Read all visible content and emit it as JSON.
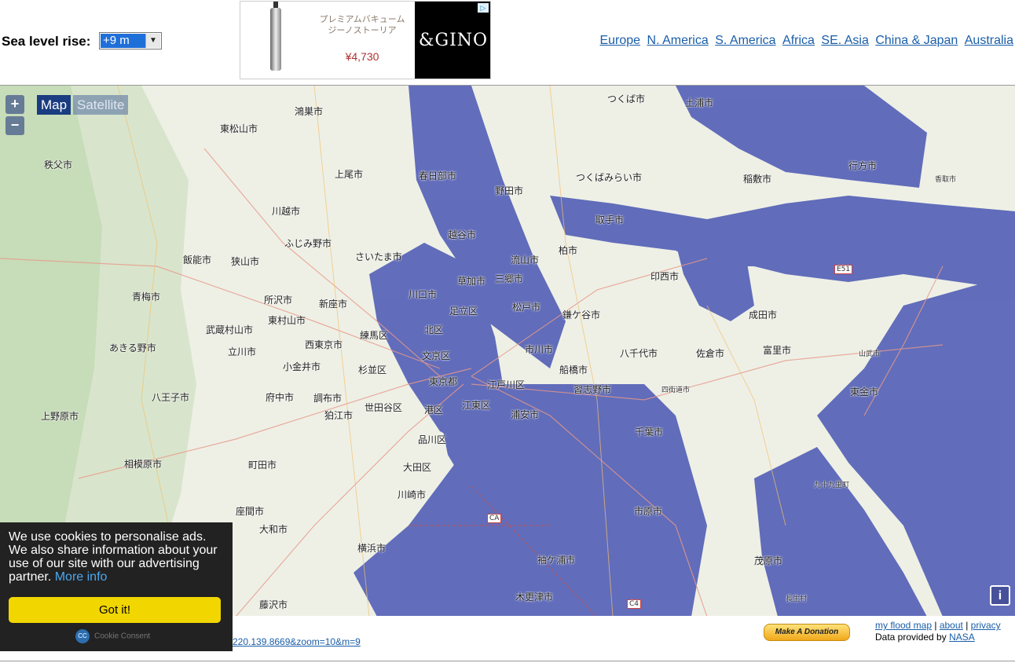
{
  "header": {
    "sea_level_label": "Sea level rise:",
    "sea_level_value": "+9 m"
  },
  "ad": {
    "product_text": "プレミアムバキューム ジーノストーリア",
    "price": "¥4,730",
    "brand": "&GINO"
  },
  "regions": [
    "Europe",
    "N. America",
    "S. America",
    "Africa",
    "SE. Asia",
    "China & Japan",
    "Australia"
  ],
  "map_controls": {
    "zoom_in": "+",
    "zoom_out": "−",
    "map_tab": "Map",
    "satellite_tab": "Satellite",
    "info": "i"
  },
  "map_labels": {
    "tsukuba": "つくば市",
    "tsuchiura": "土浦市",
    "higashimatsuyama": "東松山市",
    "konosu": "鴻巣市",
    "chichibu": "秩父市",
    "kamio": "上尾市",
    "kasukabe": "春日部市",
    "noda": "野田市",
    "tsukubamirai": "つくばみらい市",
    "inashiki": "稲敷市",
    "namegata": "行方市",
    "kawagoe": "川越市",
    "fujimino": "ふじみ野市",
    "saitama": "さいたま市",
    "koshigaya": "越谷市",
    "nagareyama": "流山市",
    "kashiwa": "柏市",
    "toride": "取手市",
    "hanno": "飯能市",
    "sayama": "狭山市",
    "kawaguchi": "川口市",
    "soka": "草加市",
    "misato": "三郷市",
    "inzai": "印西市",
    "ome": "青梅市",
    "tokorozawa": "所沢市",
    "niiza": "新座市",
    "adachi": "足立区",
    "matsudo": "松戸市",
    "kamagaya": "鎌ケ谷市",
    "narita": "成田市",
    "musashimurayama": "武蔵村山市",
    "higashimurayama": "東村山市",
    "kita": "北区",
    "nerima": "練馬区",
    "akiruno": "あきる野市",
    "tachikawa": "立川市",
    "nishitokyo": "西東京市",
    "bunkyo": "文京区",
    "ichikawa": "市川市",
    "yachiyo": "八千代市",
    "sakura": "佐倉市",
    "tomisato": "富里市",
    "koganei": "小金井市",
    "suginami": "杉並区",
    "funabashi": "船橋市",
    "tokyo": "東京都",
    "edogawa": "江戸川区",
    "narashino": "習志野市",
    "hachioji": "八王子市",
    "fuchu": "府中市",
    "chofu": "調布市",
    "setagaya": "世田谷区",
    "koto": "江東区",
    "uenohara": "上野原市",
    "komae": "狛江市",
    "minato": "港区",
    "urayasu": "浦安市",
    "chiba": "千葉市",
    "togane": "東金市",
    "shinagawa": "品川区",
    "sagamihara": "相模原市",
    "machida": "町田市",
    "ota": "大田区",
    "kujukuri": "九十九里町",
    "kawasaki": "川崎市",
    "zama": "座間市",
    "ichihara": "市原市",
    "yamato": "大和市",
    "yokohama": "横浜市",
    "mobara": "茂原市",
    "fujisawa": "藤沢市",
    "kisarazu": "木更津市",
    "sodegaura": "袖ケ浦市",
    "katori": "香取市",
    "yotsukaido": "四街道市",
    "sanbu": "山武市",
    "chosei": "長生村",
    "e51": "E51",
    "c4": "C4",
    "ca": "CA"
  },
  "cookie": {
    "message": "We use cookies to personalise ads. We also share information about your use of our site with our advertising partner.",
    "more_info": "More info",
    "button": "Got it!",
    "brand": "Cookie Consent"
  },
  "footer": {
    "url_fragment": "220.139.8669&zoom=10&m=9",
    "donate": "Make A Donation",
    "link_myflood": "my flood map",
    "link_about": "about",
    "link_privacy": "privacy",
    "provided_by": "Data provided by",
    "nasa": "NASA"
  },
  "colors": {
    "flood": "#5a65b8",
    "land": "#eef0e6",
    "accent_link": "#1a5ea8",
    "cookie_bg": "#222222",
    "cookie_btn": "#f1d600"
  }
}
